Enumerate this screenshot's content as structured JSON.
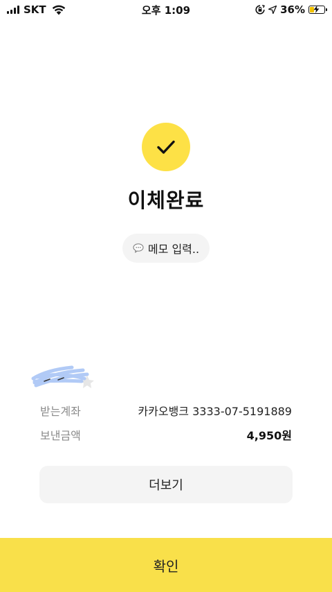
{
  "status_bar": {
    "carrier": "SKT",
    "time": "오후 1:09",
    "battery_percent": "36%",
    "battery_level": 0.36,
    "icons": [
      "signal-icon",
      "wifi-icon",
      "rotation-lock-icon",
      "location-arrow-icon",
      "battery-charging-icon"
    ]
  },
  "header": {
    "title": "이체완료"
  },
  "memo": {
    "label": "메모 입력.."
  },
  "details": {
    "account_label": "받는계좌",
    "account_value": "카카오뱅크 3333-07-5191889",
    "amount_label": "보낸금액",
    "amount_value": "4,950원"
  },
  "buttons": {
    "more_label": "더보기",
    "confirm_label": "확인"
  },
  "colors": {
    "accent_yellow": "#fde146",
    "confirm_bar": "#f9e04a",
    "muted_text": "#8a8a8a",
    "button_bg": "#f4f4f4"
  }
}
